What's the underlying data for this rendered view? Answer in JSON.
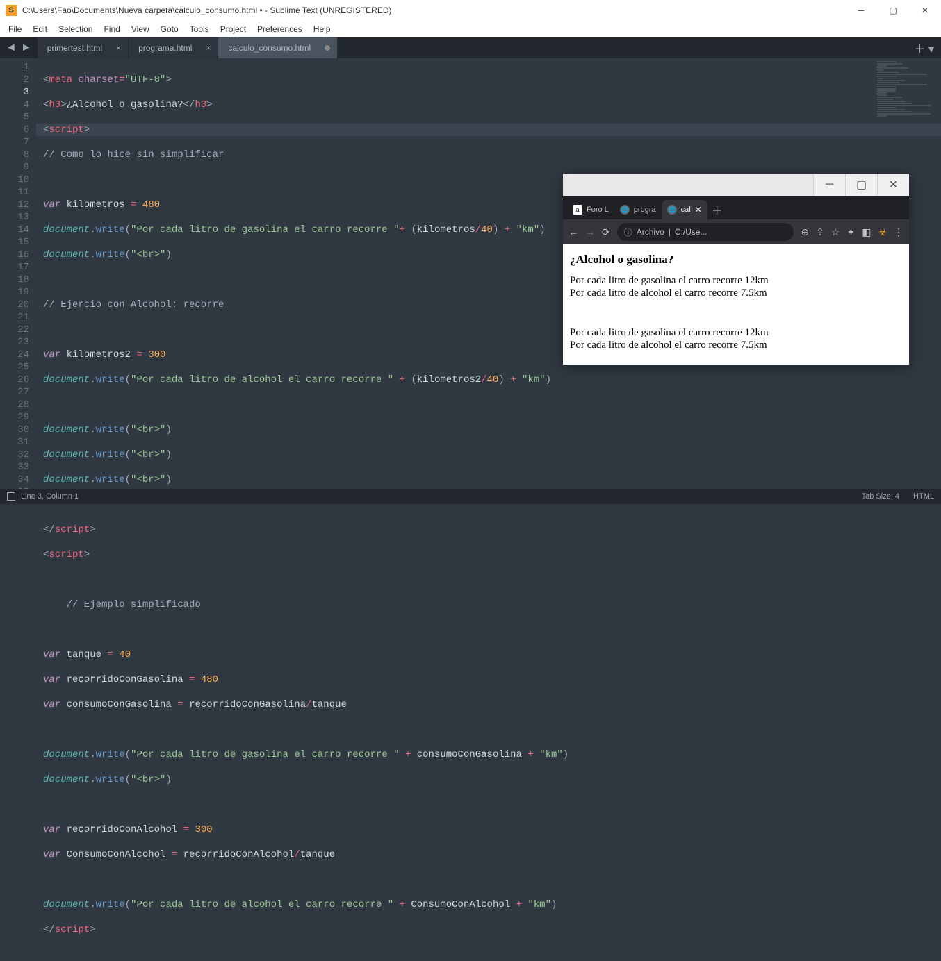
{
  "window": {
    "title": "C:\\Users\\Fao\\Documents\\Nueva carpeta\\calculo_consumo.html • - Sublime Text (UNREGISTERED)"
  },
  "menu": [
    "File",
    "Edit",
    "Selection",
    "Find",
    "View",
    "Goto",
    "Tools",
    "Project",
    "Preferences",
    "Help"
  ],
  "tabs": [
    {
      "label": "primertest.html",
      "active": false,
      "modified": false
    },
    {
      "label": "programa.html",
      "active": false,
      "modified": true
    },
    {
      "label": "calculo_consumo.html",
      "active": true,
      "modified": true
    }
  ],
  "status": {
    "pos": "Line 3, Column 1",
    "tabsize": "Tab Size: 4",
    "lang": "HTML"
  },
  "browser": {
    "tabs": [
      {
        "label": "Foro L",
        "icon": "a"
      },
      {
        "label": "progra",
        "icon": "◉"
      },
      {
        "label": "cal",
        "icon": "◉",
        "active": true
      }
    ],
    "addr_label": "Archivo",
    "addr_path": "C:/Use...",
    "page": {
      "heading": "¿Alcohol o gasolina?",
      "line1": "Por cada litro de gasolina el carro recorre 12km",
      "line2": "Por cada litro de alcohol el carro recorre 7.5km",
      "line3": "Por cada litro de gasolina el carro recorre 12km",
      "line4": "Por cada litro de alcohol el carro recorre 7.5km"
    }
  },
  "code": {
    "l1": {
      "a": "<",
      "b": "meta ",
      "c": "charset",
      "d": "=",
      "e": "\"UTF-8\"",
      "f": ">"
    },
    "l2": {
      "a": "<",
      "b": "h3",
      "c": ">",
      "d": "¿Alcohol o gasolina?",
      "e": "</",
      "f": "h3",
      "g": ">"
    },
    "l3": {
      "a": "<",
      "b": "script",
      "c": ">"
    },
    "l4": "// Como lo hice sin simplificar",
    "l6a": "var ",
    "l6b": "kilometros ",
    "l6c": "= ",
    "l6d": "480",
    "l7a": "document",
    "l7b": ".",
    "l7c": "write",
    "l7d": "(",
    "l7e": "\"Por cada litro de gasolina el carro recorre \"",
    "l7f": "+ ",
    "l7g": "(",
    "l7h": "kilometros",
    "l7i": "/",
    "l7j": "40",
    "l7k": ") ",
    "l7l": "+ ",
    "l7m": "\"km\"",
    "l7n": ")",
    "l8a": "document",
    "l8b": ".",
    "l8c": "write",
    "l8d": "(",
    "l8e": "\"<br>\"",
    "l8f": ")",
    "l10": "// Ejercio con Alcohol: recorre",
    "l12a": "var ",
    "l12b": "kilometros2 ",
    "l12c": "= ",
    "l12d": "300",
    "l13a": "document",
    "l13b": ".",
    "l13c": "write",
    "l13d": "(",
    "l13e": "\"Por cada litro de alcohol el carro recorre \" ",
    "l13f": "+ ",
    "l13g": "(",
    "l13h": "kilometros2",
    "l13i": "/",
    "l13j": "40",
    "l13k": ") ",
    "l13l": "+ ",
    "l13m": "\"km\"",
    "l13n": ")",
    "l15a": "document",
    "l15b": ".",
    "l15c": "write",
    "l15d": "(",
    "l15e": "\"<br>\"",
    "l15f": ")",
    "l19a": "</",
    "l19b": "script",
    "l19c": ">",
    "l20a": "<",
    "l20b": "script",
    "l20c": ">",
    "l22": "    // Ejemplo simplificado",
    "l24a": "var ",
    "l24b": "tanque ",
    "l24c": "= ",
    "l24d": "40",
    "l25a": "var ",
    "l25b": "recorridoConGasolina ",
    "l25c": "= ",
    "l25d": "480",
    "l26a": "var ",
    "l26b": "consumoConGasolina ",
    "l26c": "= ",
    "l26d": "recorridoConGasolina",
    "l26e": "/",
    "l26f": "tanque",
    "l28a": "document",
    "l28b": ".",
    "l28c": "write",
    "l28d": "(",
    "l28e": "\"Por cada litro de gasolina el carro recorre \" ",
    "l28f": "+ ",
    "l28g": "consumoConGasolina ",
    "l28h": "+ ",
    "l28i": "\"km\"",
    "l28j": ")",
    "l29a": "document",
    "l29b": ".",
    "l29c": "write",
    "l29d": "(",
    "l29e": "\"<br>\"",
    "l29f": ")",
    "l31a": "var ",
    "l31b": "recorridoConAlcohol ",
    "l31c": "= ",
    "l31d": "300",
    "l32a": "var ",
    "l32b": "ConsumoConAlcohol ",
    "l32c": "= ",
    "l32d": "recorridoConAlcohol",
    "l32e": "/",
    "l32f": "tanque",
    "l34a": "document",
    "l34b": ".",
    "l34c": "write",
    "l34d": "(",
    "l34e": "\"Por cada litro de alcohol el carro recorre \" ",
    "l34f": "+ ",
    "l34g": "ConsumoConAlcohol ",
    "l34h": "+ ",
    "l34i": "\"km\"",
    "l34j": ")",
    "l35a": "</",
    "l35b": "script",
    "l35c": ">"
  }
}
